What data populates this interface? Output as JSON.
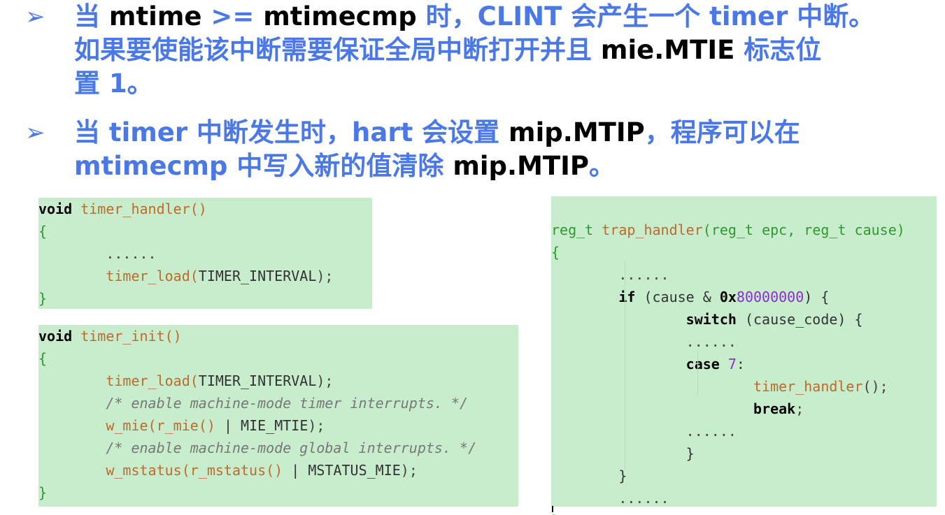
{
  "bullets": [
    {
      "marker": "➢",
      "lines": [
        [
          {
            "t": "当 ",
            "k": false
          },
          {
            "t": "mtime ",
            "k": true
          },
          {
            "t": ">= ",
            "k": false
          },
          {
            "t": "mtimecmp ",
            "k": true
          },
          {
            "t": "时，CLINT 会产生一个 timer 中断。",
            "k": false
          }
        ],
        [
          {
            "t": "如果要使能该中断需要保证全局中断打开并且 ",
            "k": false
          },
          {
            "t": "mie.MTIE ",
            "k": true
          },
          {
            "t": "标志位",
            "k": false
          }
        ],
        [
          {
            "t": "置 1。",
            "k": false
          }
        ]
      ]
    },
    {
      "marker": "➢",
      "lines": [
        [
          {
            "t": "当 timer 中断发生时，hart 会设置 ",
            "k": false
          },
          {
            "t": "mip.MTIP",
            "k": true
          },
          {
            "t": "，程序可以在",
            "k": false
          }
        ],
        [
          {
            "t": "mtimecmp 中写入新的值清除 ",
            "k": false
          },
          {
            "t": "mip.MTIP",
            "k": true
          },
          {
            "t": "。",
            "k": false
          }
        ]
      ]
    }
  ],
  "code_blocks": {
    "timer_handler": [
      [
        {
          "t": "void",
          "c": "kw"
        },
        {
          "t": " "
        },
        {
          "t": "timer_handler",
          "c": "fn"
        },
        {
          "t": "()",
          "c": "fn"
        }
      ],
      [
        {
          "t": "{",
          "c": "br"
        }
      ],
      [
        {
          "t": "        "
        },
        {
          "t": "......",
          "c": "pn"
        }
      ],
      [
        {
          "t": "        "
        },
        {
          "t": "timer_load",
          "c": "fn"
        },
        {
          "t": "(",
          "c": "fn"
        },
        {
          "t": "TIMER_INTERVAL"
        },
        {
          "t": ");",
          "c": "pn"
        }
      ],
      [
        {
          "t": "}",
          "c": "br"
        }
      ]
    ],
    "timer_init": [
      [
        {
          "t": "void",
          "c": "kw"
        },
        {
          "t": " "
        },
        {
          "t": "timer_init",
          "c": "fn"
        },
        {
          "t": "()",
          "c": "fn"
        }
      ],
      [
        {
          "t": "{",
          "c": "br"
        }
      ],
      [
        {
          "t": "        "
        },
        {
          "t": "timer_load",
          "c": "fn"
        },
        {
          "t": "(",
          "c": "fn"
        },
        {
          "t": "TIMER_INTERVAL"
        },
        {
          "t": ");",
          "c": "pn"
        }
      ],
      [
        {
          "t": "        "
        },
        {
          "t": "/* enable machine-mode timer interrupts. */",
          "c": "cm"
        }
      ],
      [
        {
          "t": "        "
        },
        {
          "t": "w_mie",
          "c": "fn"
        },
        {
          "t": "(",
          "c": "fn"
        },
        {
          "t": "r_mie",
          "c": "fn"
        },
        {
          "t": "()",
          "c": "fn"
        },
        {
          "t": " | "
        },
        {
          "t": "MIE_MTIE"
        },
        {
          "t": ");",
          "c": "pn"
        }
      ],
      [
        {
          "t": "        "
        },
        {
          "t": "/* enable machine-mode global interrupts. */",
          "c": "cm"
        }
      ],
      [
        {
          "t": "        "
        },
        {
          "t": "w_mstatus",
          "c": "fn"
        },
        {
          "t": "(",
          "c": "fn"
        },
        {
          "t": "r_mstatus",
          "c": "fn"
        },
        {
          "t": "()",
          "c": "fn"
        },
        {
          "t": " | "
        },
        {
          "t": "MSTATUS_MIE"
        },
        {
          "t": ");",
          "c": "pn"
        }
      ],
      [
        {
          "t": "}",
          "c": "br"
        }
      ]
    ],
    "trap_handler": [
      [
        {
          "t": "reg_t",
          "c": "br"
        },
        {
          "t": " "
        },
        {
          "t": "trap_handler",
          "c": "fn"
        },
        {
          "t": "(",
          "c": "br"
        },
        {
          "t": "reg_t",
          "c": "br"
        },
        {
          "t": " "
        },
        {
          "t": "epc",
          "c": "br"
        },
        {
          "t": ", ",
          "c": "br"
        },
        {
          "t": "reg_t",
          "c": "br"
        },
        {
          "t": " "
        },
        {
          "t": "cause",
          "c": "br"
        },
        {
          "t": ")",
          "c": "br"
        }
      ],
      [
        {
          "t": "{",
          "c": "br"
        }
      ],
      [
        {
          "t": "        "
        },
        {
          "t": "......",
          "c": "pn"
        }
      ],
      [
        {
          "t": "        "
        },
        {
          "t": "if",
          "c": "kw"
        },
        {
          "t": " (cause & "
        },
        {
          "t": "0x",
          "c": "kw"
        },
        {
          "t": "80000000",
          "c": "nm"
        },
        {
          "t": ") {"
        }
      ],
      [
        {
          "t": "                "
        },
        {
          "t": "switch",
          "c": "kw"
        },
        {
          "t": " (cause_code) {"
        }
      ],
      [
        {
          "t": "                "
        },
        {
          "t": "......",
          "c": "pn"
        }
      ],
      [
        {
          "t": "                "
        },
        {
          "t": "case",
          "c": "kw"
        },
        {
          "t": " "
        },
        {
          "t": "7",
          "c": "nm"
        },
        {
          "t": ":"
        }
      ],
      [
        {
          "t": "                        "
        },
        {
          "t": "timer_handler",
          "c": "fn"
        },
        {
          "t": "();",
          "c": "pn"
        }
      ],
      [
        {
          "t": "                        "
        },
        {
          "t": "break",
          "c": "kw"
        },
        {
          "t": ";",
          "c": "pn"
        }
      ],
      [
        {
          "t": "                "
        },
        {
          "t": "......",
          "c": "pn"
        }
      ],
      [
        {
          "t": "                }"
        }
      ],
      [
        {
          "t": "        }"
        }
      ],
      [
        {
          "t": "        "
        },
        {
          "t": "......",
          "c": "pn"
        }
      ],
      [
        {
          "t": "}",
          "c": "br"
        }
      ]
    ]
  },
  "colors": {
    "accent_blue": "#4a78e6",
    "code_bg": "#c8edcc"
  }
}
